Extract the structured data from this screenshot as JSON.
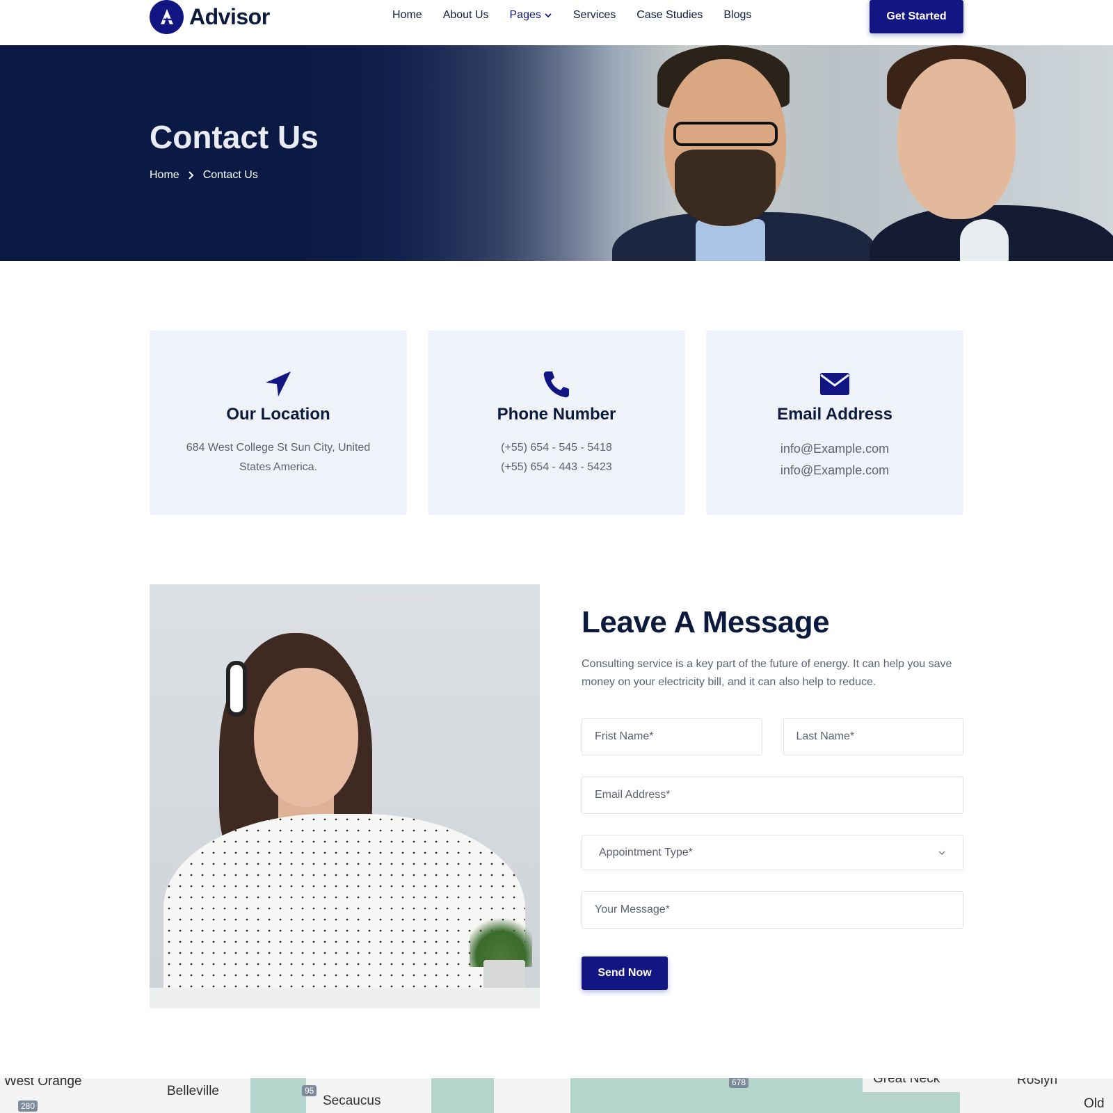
{
  "header": {
    "brand": "Advisor",
    "nav": [
      {
        "label": "Home"
      },
      {
        "label": "About Us"
      },
      {
        "label": "Pages"
      },
      {
        "label": "Services"
      },
      {
        "label": "Case Studies"
      },
      {
        "label": "Blogs"
      }
    ],
    "cta_label": "Get Started"
  },
  "hero": {
    "title": "Contact Us",
    "breadcrumb": {
      "home": "Home",
      "current": "Contact Us"
    }
  },
  "cards": {
    "location": {
      "title": "Our Location",
      "line1": "684 West College St Sun City, United States America."
    },
    "phone": {
      "title": "Phone Number",
      "line1": "(+55) 654 - 545 - 5418",
      "line2": "(+55) 654 - 443 - 5423"
    },
    "email": {
      "title": "Email Address",
      "line1": "info@Example.com",
      "line2": "info@Example.com"
    }
  },
  "message": {
    "title": "Leave A Message",
    "description": "Consulting service is a key part of the future of energy. It can help you save money on your electricity bill, and it can also help to reduce.",
    "first_name_placeholder": "Frist Name*",
    "last_name_placeholder": "Last Name*",
    "email_placeholder": "Email Address*",
    "appointment_selected": "Appointment Type*",
    "message_placeholder": "Your Message*",
    "send_label": "Send Now"
  },
  "map": {
    "labels": [
      "West Orange",
      "Belleville",
      "Secaucus",
      "Great Neck",
      "Roslyn",
      "Old W"
    ],
    "shields": [
      "280",
      "95",
      "678"
    ]
  },
  "colors": {
    "primary": "#121683",
    "navy": "#0c1b3d",
    "card_bg": "#eff2f8",
    "text_muted": "#5b6272"
  },
  "icons": [
    "logo-a-icon",
    "chevron-down-icon",
    "chevron-right-icon",
    "navigation-arrow-icon",
    "phone-icon",
    "envelope-icon"
  ]
}
